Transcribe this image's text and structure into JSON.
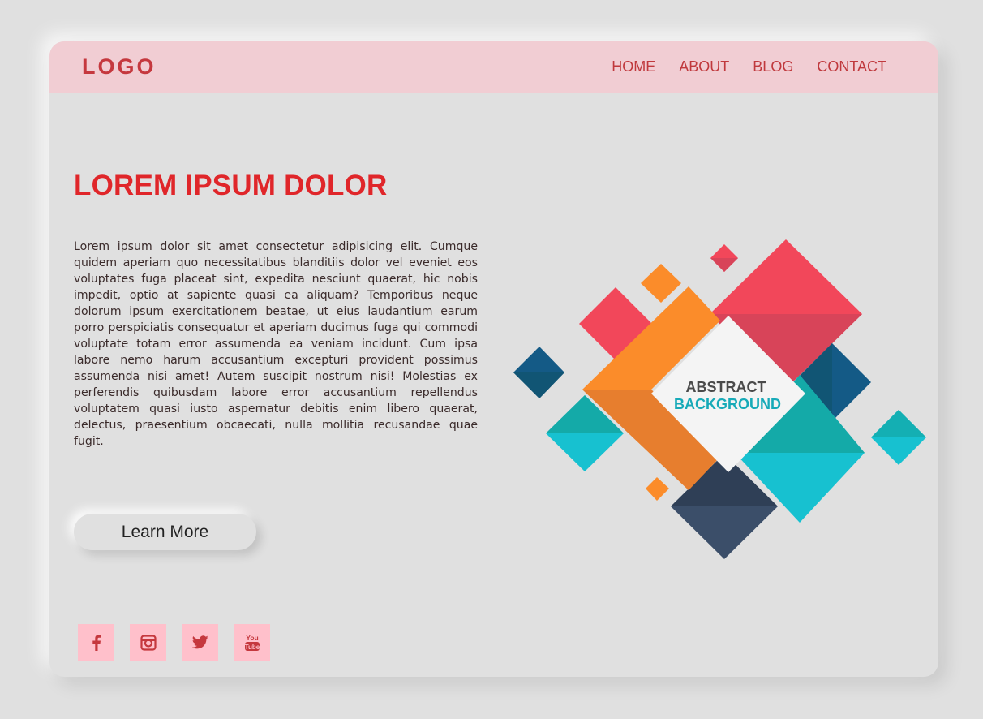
{
  "header": {
    "logo": "LOGO",
    "nav": [
      "HOME",
      "ABOUT",
      "BLOG",
      "CONTACT"
    ]
  },
  "hero": {
    "title": "LOREM IPSUM DOLOR",
    "paragraph": "Lorem ipsum dolor sit amet consectetur adipisicing elit. Cumque quidem aperiam quo necessitatibus blanditiis dolor vel eveniet eos voluptates fuga placeat sint, expedita nesciunt quaerat, hic nobis impedit, optio at sapiente quasi ea aliquam? Temporibus neque dolorum ipsum exercitationem beatae, ut eius laudantium earum porro perspiciatis consequatur et aperiam ducimus fuga qui commodi voluptate totam error assumenda ea veniam incidunt. Cum ipsa labore nemo harum accusantium excepturi provident possimus assumenda nisi amet! Autem suscipit nostrum nisi! Molestias ex perferendis quibusdam labore error accusantium repellendus voluptatem quasi iusto aspernatur debitis enim libero quaerat, delectus, praesentium obcaecati, nulla mollitia recusandae quae fugit.",
    "button": "Learn More"
  },
  "illustration": {
    "line1": "ABSTRACT",
    "line2": "BACKGROUND"
  },
  "social": {
    "icons": [
      "facebook-icon",
      "instagram-icon",
      "twitter-icon",
      "youtube-icon"
    ],
    "youtube_text_top": "You",
    "youtube_text_bottom": "Tube"
  },
  "colors": {
    "accent": "#e0262a",
    "header_bg": "#f1cdd3",
    "social_bg": "#ffc0cb",
    "red": "#f2475a",
    "orange": "#fb8c2a",
    "teal": "#17c1d0",
    "navy": "#145a86",
    "slate": "#3b4e69"
  }
}
